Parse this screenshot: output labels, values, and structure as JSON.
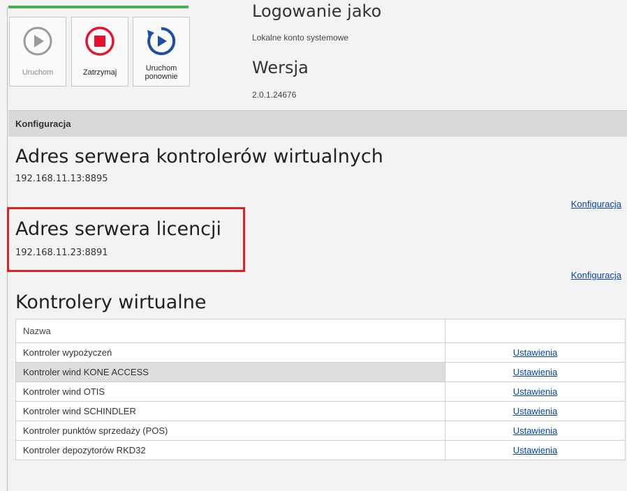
{
  "toolbar": {
    "start_label": "Uruchom",
    "stop_label": "Zatrzymaj",
    "restart_label": "Uruchom ponownie"
  },
  "info": {
    "login_title": "Logowanie jako",
    "login_value": "Lokalne konto systemowe",
    "version_title": "Wersja",
    "version_value": "2.0.1.24676"
  },
  "config_section": {
    "header": "Konfiguracja",
    "virtual_server_title": "Adres serwera kontrolerów wirtualnych",
    "virtual_server_address": "192.168.11.13:8895",
    "virtual_server_link": "Konfiguracja",
    "license_server_title": "Adres serwera licencji",
    "license_server_address": "192.168.11.23:8891",
    "license_server_link": "Konfiguracja"
  },
  "controllers": {
    "title": "Kontrolery wirtualne",
    "column_name": "Nazwa",
    "column_actions": "",
    "rows": [
      {
        "name": "Kontroler wypożyczeń",
        "action": "Ustawienia"
      },
      {
        "name": "Kontroler wind KONE ACCESS",
        "action": "Ustawienia"
      },
      {
        "name": "Kontroler wind OTIS",
        "action": "Ustawienia"
      },
      {
        "name": "Kontroler wind SCHINDLER",
        "action": "Ustawienia"
      },
      {
        "name": "Kontroler punktów sprzedaży (POS)",
        "action": "Ustawienia"
      },
      {
        "name": "Kontroler depozytorów RKD32",
        "action": "Ustawienia"
      }
    ],
    "selected_row": 1
  },
  "colors": {
    "accent_green": "#4caf50",
    "stop_red": "#e8112d",
    "restart_blue": "#1f4fa3",
    "highlight_red": "#e02020",
    "link_blue": "#0645ad"
  },
  "icons": {
    "start": "play-circle-icon",
    "stop": "stop-circle-icon",
    "restart": "restart-circle-icon"
  }
}
